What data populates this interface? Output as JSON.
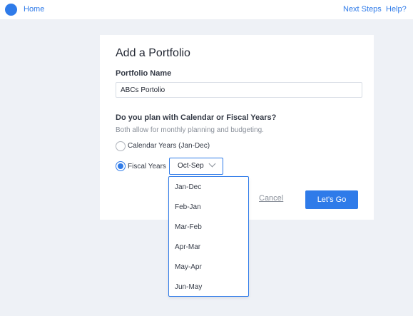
{
  "header": {
    "home_label": "Home",
    "next_steps_label": "Next Steps",
    "help_label": "Help?"
  },
  "form": {
    "title": "Add a Portfolio",
    "name_label": "Portfolio Name",
    "name_value": "ABCs Portolio",
    "question": "Do you plan with Calendar or Fiscal Years?",
    "help_text": "Both allow for monthly planning and budgeting.",
    "calendar_label": "Calendar Years (Jan-Dec)",
    "fiscal_label": "Fiscal Years",
    "selected_period": "Oct-Sep",
    "cancel_label": "Cancel",
    "submit_label": "Let's Go"
  },
  "dropdown": {
    "options": [
      "Jan-Dec",
      "Feb-Jan",
      "Mar-Feb",
      "Apr-Mar",
      "May-Apr",
      "Jun-May"
    ]
  },
  "colors": {
    "accent": "#2f7be9",
    "page_background": "#eef1f6"
  }
}
